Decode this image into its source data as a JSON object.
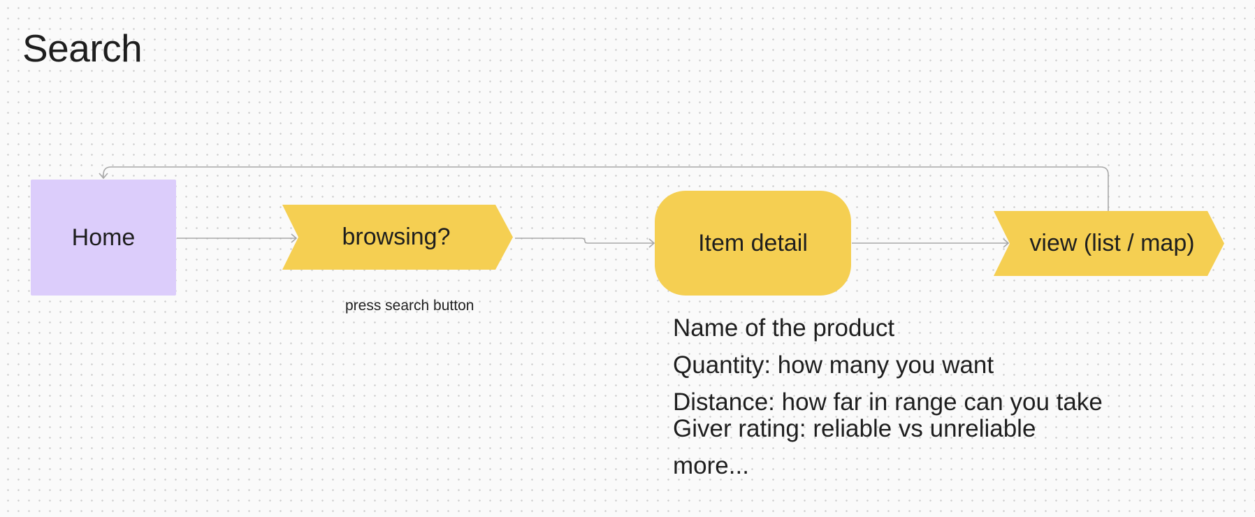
{
  "board": {
    "title": "Search",
    "background": "#fafafa",
    "grid_dot_color": "#cfcfcf"
  },
  "nodes": {
    "home": {
      "label": "Home",
      "shape": "rectangle",
      "color": "#dccdfb"
    },
    "browsing": {
      "label": "browsing?",
      "shape": "chevron",
      "color": "#f5cf52"
    },
    "item_detail": {
      "label": "Item detail",
      "shape": "rounded-rectangle",
      "color": "#f5cf52"
    },
    "view": {
      "label": "view (list / map)",
      "shape": "chevron",
      "color": "#f5cf52"
    }
  },
  "edges": {
    "home_to_browsing": {
      "label": ""
    },
    "browsing_to_item": {
      "label": "press search button"
    },
    "item_to_view": {
      "label": ""
    },
    "view_to_home": {
      "label": ""
    },
    "color": "#a8a8a8"
  },
  "notes": [
    "Name of the product",
    "Quantity: how many you want",
    "Distance: how far in range can you take",
    "Giver rating: reliable vs unreliable",
    "more..."
  ]
}
